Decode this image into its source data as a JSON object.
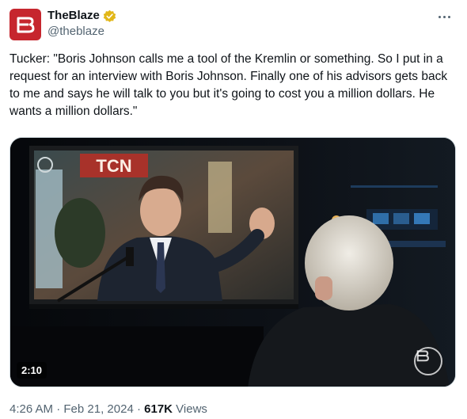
{
  "author": {
    "display_name": "TheBlaze",
    "handle": "@theblaze",
    "avatar_color": "#c6262e",
    "verified_color": "#e2b719"
  },
  "tweet": {
    "text": "Tucker: \"Boris Johnson calls me a tool of the Kremlin or something. So I put in a request for an interview with Boris Johnson. Finally one of his advisors gets back to me and says he will talk to you but it's going to cost you a million dollars. He wants a million dollars.\""
  },
  "media": {
    "type": "video",
    "duration": "2:10",
    "screen_logo": "TCN"
  },
  "meta": {
    "time": "4:26 AM",
    "separator": "·",
    "date": "Feb 21, 2024",
    "views_count": "617K",
    "views_label": "Views"
  },
  "icons": {
    "more": "more-horizontal-icon",
    "verified": "verified-badge-icon",
    "watermark": "blaze-logo-icon"
  }
}
